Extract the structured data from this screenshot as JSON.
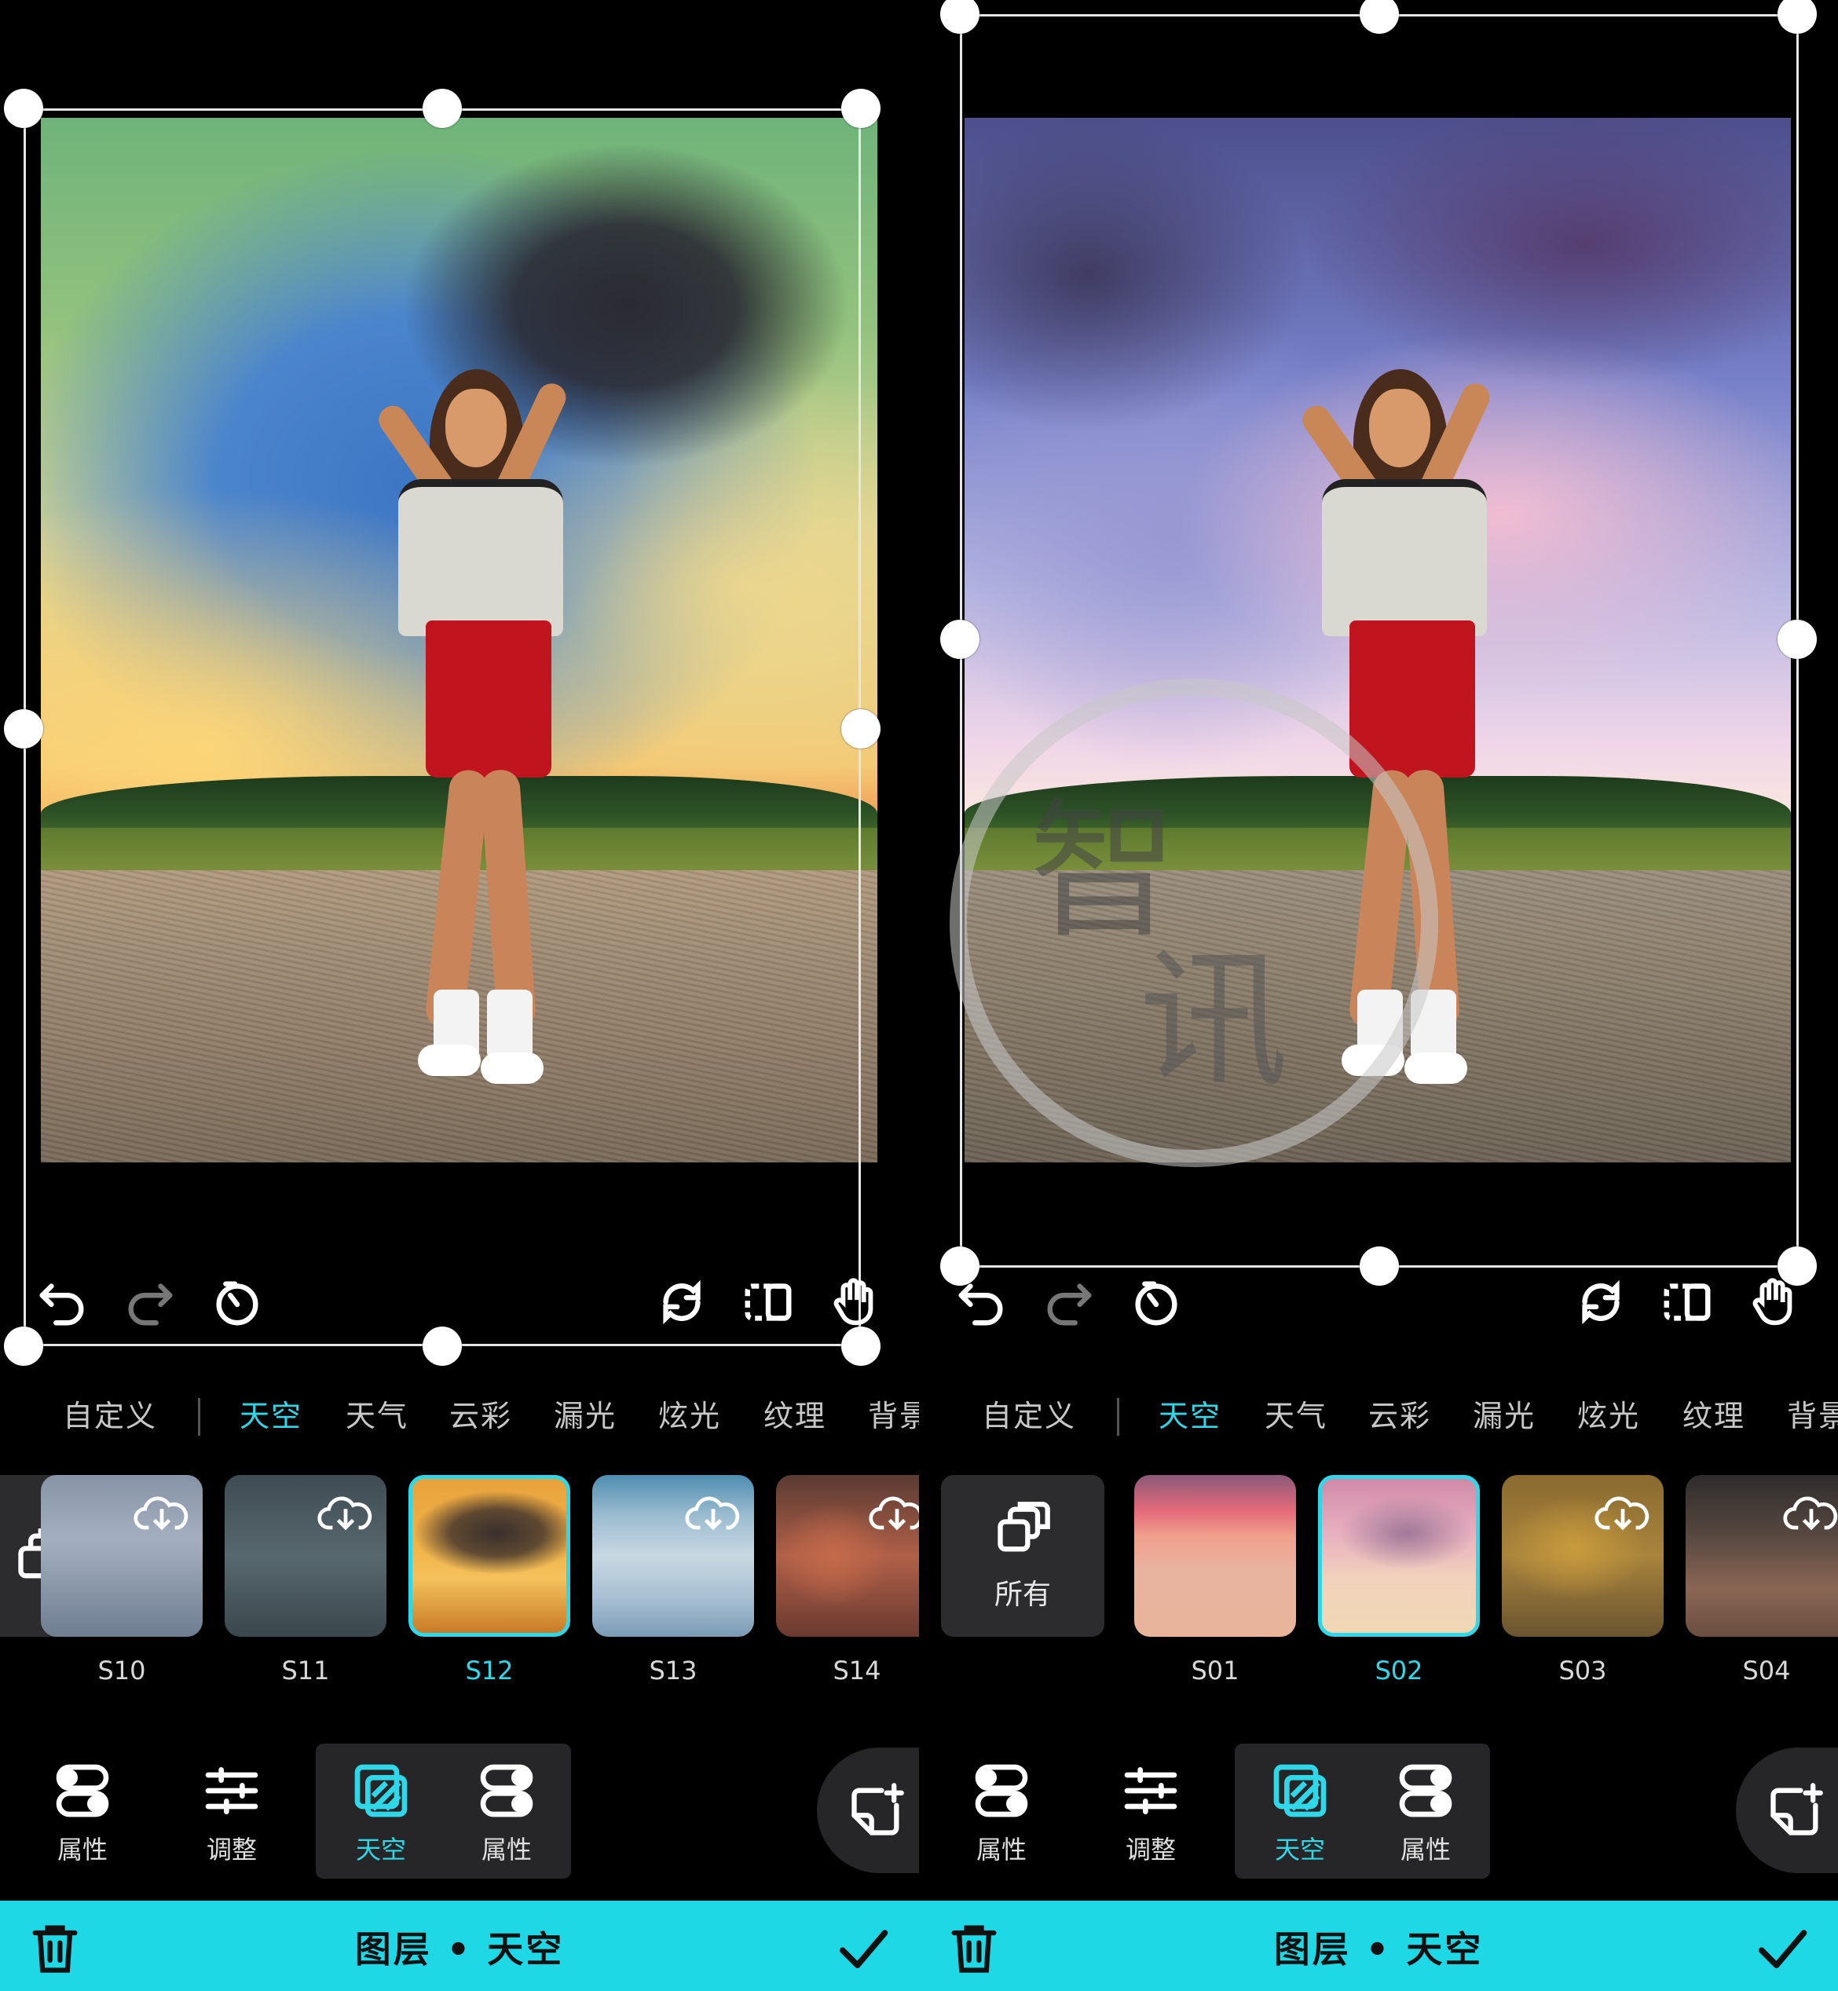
{
  "panels": [
    {
      "tabs": [
        "自定义",
        "天空",
        "天气",
        "云彩",
        "漏光",
        "炫光",
        "纹理",
        "背景"
      ],
      "active_tab": "天空",
      "thumbnails": [
        {
          "label": "S10",
          "download": true,
          "selected": false
        },
        {
          "label": "S11",
          "download": true,
          "selected": false
        },
        {
          "label": "S12",
          "download": false,
          "selected": true
        },
        {
          "label": "S13",
          "download": true,
          "selected": false
        },
        {
          "label": "S14",
          "download": true,
          "selected": false
        }
      ],
      "dock": [
        {
          "label": "属性",
          "icon": "toggle-icon"
        },
        {
          "label": "调整",
          "icon": "sliders-icon"
        },
        {
          "label": "天空",
          "icon": "sky-layer-icon",
          "active": true
        },
        {
          "label": "属性",
          "icon": "toggle-icon"
        }
      ],
      "footer_title": "图层 • 天空"
    },
    {
      "tabs": [
        "自定义",
        "天空",
        "天气",
        "云彩",
        "漏光",
        "炫光",
        "纹理",
        "背景"
      ],
      "active_tab": "天空",
      "all_label": "所有",
      "thumbnails": [
        {
          "label": "S01",
          "download": false,
          "selected": false
        },
        {
          "label": "S02",
          "download": false,
          "selected": true
        },
        {
          "label": "S03",
          "download": true,
          "selected": false
        },
        {
          "label": "S04",
          "download": true,
          "selected": false
        }
      ],
      "dock": [
        {
          "label": "属性",
          "icon": "toggle-icon"
        },
        {
          "label": "调整",
          "icon": "sliders-icon"
        },
        {
          "label": "天空",
          "icon": "sky-layer-icon",
          "active": true
        },
        {
          "label": "属性",
          "icon": "toggle-icon"
        }
      ],
      "footer_title": "图层 • 天空"
    }
  ],
  "colors": {
    "accent": "#2fd8e8",
    "footer": "#1fd8e6"
  },
  "watermark": {
    "text_1": "智",
    "text_2": "讯"
  }
}
